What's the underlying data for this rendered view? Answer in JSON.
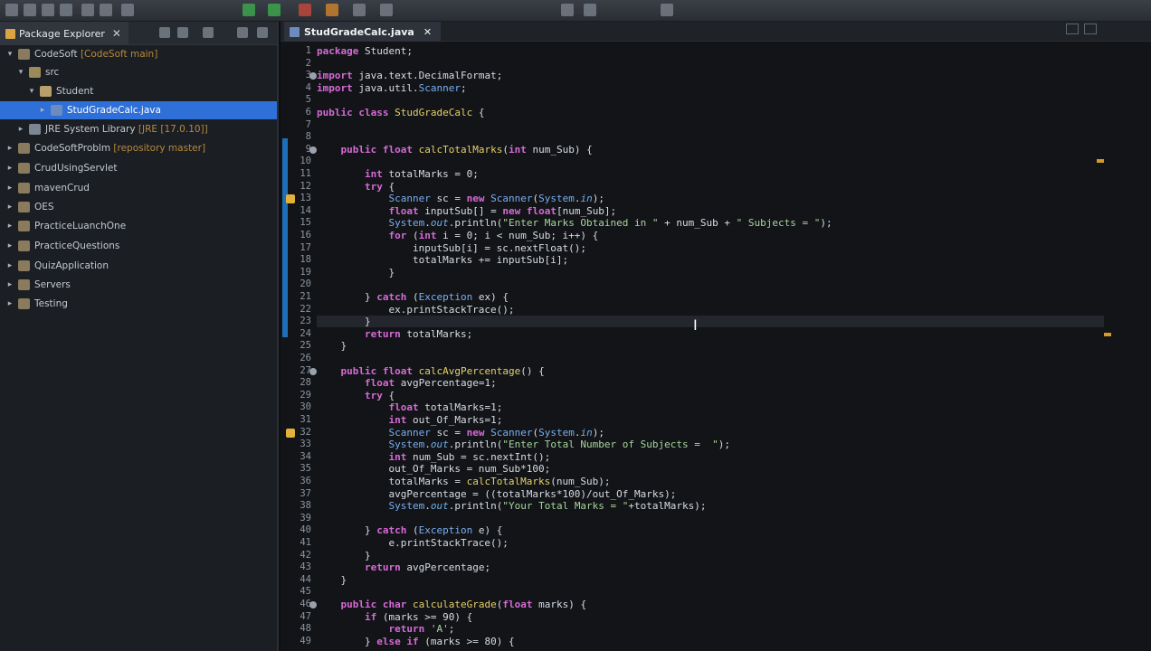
{
  "explorer": {
    "tab_label": "Package Explorer",
    "close": "✕",
    "tree": [
      {
        "label": "CodeSoft",
        "deco": "[CodeSoft main]",
        "level": 0
      },
      {
        "label": "src",
        "deco": "",
        "level": 1
      },
      {
        "label": "Student",
        "deco": "",
        "level": 2
      },
      {
        "label": "StudGradeCalc.java",
        "deco": "",
        "level": 3,
        "selected": true
      },
      {
        "label": "JRE System Library",
        "deco": "[JRE [17.0.10]]",
        "level": 1
      },
      {
        "label": "CodeSoftProblm",
        "deco": "[repository master]",
        "level": 0
      },
      {
        "label": "CrudUsingServlet",
        "deco": "",
        "level": 0
      },
      {
        "label": "mavenCrud",
        "deco": "",
        "level": 0
      },
      {
        "label": "OES",
        "deco": "",
        "level": 0
      },
      {
        "label": "PracticeLuanchOne",
        "deco": "",
        "level": 0
      },
      {
        "label": "PracticeQuestions",
        "deco": "",
        "level": 0
      },
      {
        "label": "QuizApplication",
        "deco": "",
        "level": 0
      },
      {
        "label": "Servers",
        "deco": "",
        "level": 0
      },
      {
        "label": "Testing",
        "deco": "",
        "level": 0
      }
    ]
  },
  "editor": {
    "tab_label": "StudGradeCalc.java",
    "close": "✕",
    "lines": [
      {
        "n": "1",
        "text": "package Student;"
      },
      {
        "n": "2",
        "text": ""
      },
      {
        "n": "3",
        "text": "import java.text.DecimalFormat;"
      },
      {
        "n": "4",
        "text": "import java.util.Scanner;"
      },
      {
        "n": "5",
        "text": ""
      },
      {
        "n": "6",
        "text": "public class StudGradeCalc {"
      },
      {
        "n": "7",
        "text": ""
      },
      {
        "n": "8",
        "text": ""
      },
      {
        "n": "9",
        "text": "    public float calcTotalMarks(int num_Sub) {"
      },
      {
        "n": "10",
        "text": ""
      },
      {
        "n": "11",
        "text": "        int totalMarks = 0;"
      },
      {
        "n": "12",
        "text": "        try {"
      },
      {
        "n": "13",
        "text": "            Scanner sc = new Scanner(System.in);"
      },
      {
        "n": "14",
        "text": "            float inputSub[] = new float[num_Sub];"
      },
      {
        "n": "15",
        "text": "            System.out.println(\"Enter Marks Obtained in \" + num_Sub + \" Subjects = \");"
      },
      {
        "n": "16",
        "text": "            for (int i = 0; i < num_Sub; i++) {"
      },
      {
        "n": "17",
        "text": "                inputSub[i] = sc.nextFloat();"
      },
      {
        "n": "18",
        "text": "                totalMarks += inputSub[i];"
      },
      {
        "n": "19",
        "text": "            }"
      },
      {
        "n": "20",
        "text": ""
      },
      {
        "n": "21",
        "text": "        } catch (Exception ex) {"
      },
      {
        "n": "22",
        "text": "            ex.printStackTrace();"
      },
      {
        "n": "23",
        "text": "        }"
      },
      {
        "n": "24",
        "text": "        return totalMarks;"
      },
      {
        "n": "25",
        "text": "    }"
      },
      {
        "n": "26",
        "text": ""
      },
      {
        "n": "27",
        "text": "    public float calcAvgPercentage() {"
      },
      {
        "n": "28",
        "text": "        float avgPercentage=1;"
      },
      {
        "n": "29",
        "text": "        try {"
      },
      {
        "n": "30",
        "text": "            float totalMarks=1;"
      },
      {
        "n": "31",
        "text": "            int out_Of_Marks=1;"
      },
      {
        "n": "32",
        "text": "            Scanner sc = new Scanner(System.in);"
      },
      {
        "n": "33",
        "text": "            System.out.println(\"Enter Total Number of Subjects =  \");"
      },
      {
        "n": "34",
        "text": "            int num_Sub = sc.nextInt();"
      },
      {
        "n": "35",
        "text": "            out_Of_Marks = num_Sub*100;"
      },
      {
        "n": "36",
        "text": "            totalMarks = calcTotalMarks(num_Sub);"
      },
      {
        "n": "37",
        "text": "            avgPercentage = ((totalMarks*100)/out_Of_Marks);"
      },
      {
        "n": "38",
        "text": "            System.out.println(\"Your Total Marks = \"+totalMarks);"
      },
      {
        "n": "39",
        "text": ""
      },
      {
        "n": "40",
        "text": "        } catch (Exception e) {"
      },
      {
        "n": "41",
        "text": "            e.printStackTrace();"
      },
      {
        "n": "42",
        "text": "        }"
      },
      {
        "n": "43",
        "text": "        return avgPercentage;"
      },
      {
        "n": "44",
        "text": "    }"
      },
      {
        "n": "45",
        "text": ""
      },
      {
        "n": "46",
        "text": "    public char calculateGrade(float marks) {"
      },
      {
        "n": "47",
        "text": "        if (marks >= 90) {"
      },
      {
        "n": "48",
        "text": "            return 'A';"
      },
      {
        "n": "49",
        "text": "        } else if (marks >= 80) {"
      }
    ]
  }
}
